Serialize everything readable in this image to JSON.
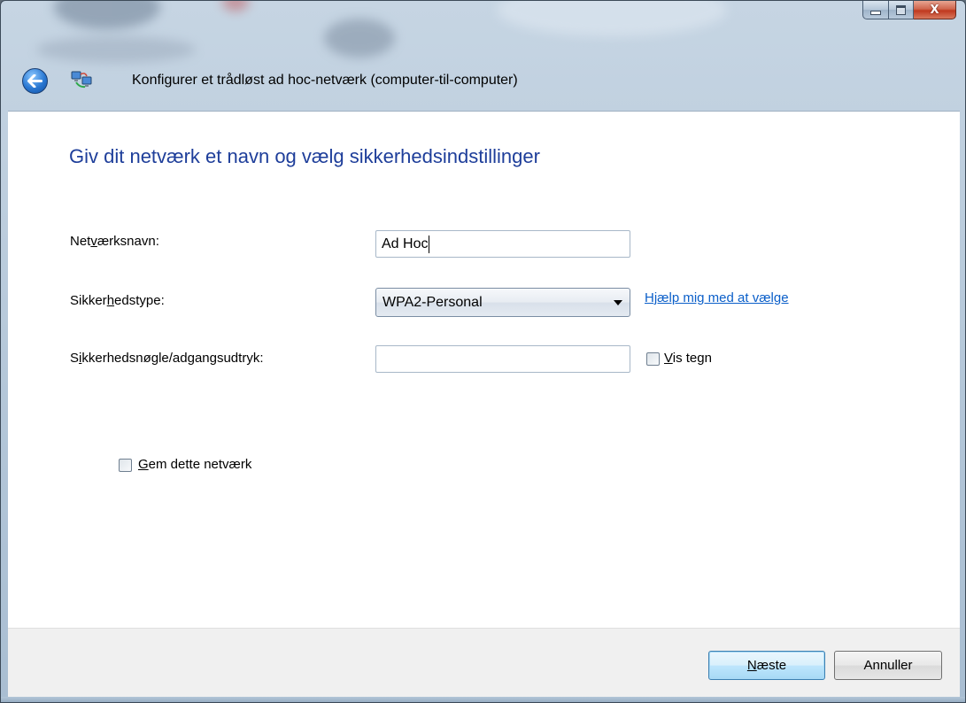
{
  "window": {
    "title": "Konfigurer et trådløst ad hoc-netværk (computer-til-computer)",
    "close_glyph": "X"
  },
  "page": {
    "heading": "Giv dit netværk et navn og vælg sikkerhedsindstillinger"
  },
  "form": {
    "network_name": {
      "label_pre": "Net",
      "label_key": "v",
      "label_post": "ærksnavn:",
      "value": "Ad Hoc"
    },
    "security_type": {
      "label_pre": "Sikker",
      "label_key": "h",
      "label_post": "edstype:",
      "value": "WPA2-Personal"
    },
    "help_link": "Hjælp mig med at vælge",
    "security_key": {
      "label_pre": "S",
      "label_key": "i",
      "label_post": "kkerhedsnøgle/adgangsudtryk:",
      "value": ""
    },
    "show_chars": {
      "label_key": "V",
      "label_post": "is tegn",
      "checked": false
    },
    "save_network": {
      "label_key": "G",
      "label_post": "em dette netværk",
      "checked": false
    }
  },
  "buttons": {
    "next_key": "N",
    "next_post": "æste",
    "cancel": "Annuller"
  }
}
